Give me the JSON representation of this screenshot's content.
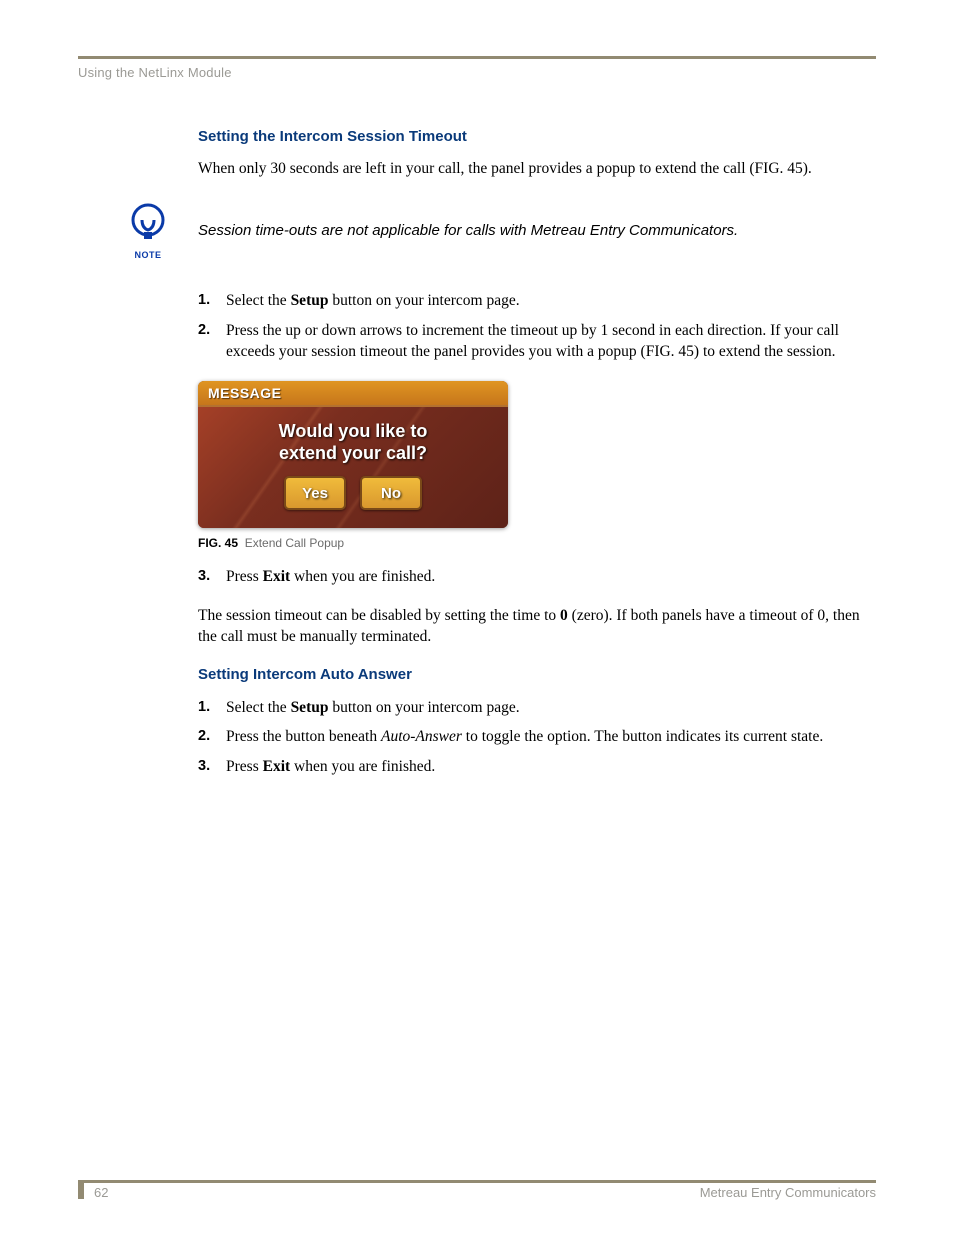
{
  "header": {
    "running_title": "Using the NetLinx Module"
  },
  "section1": {
    "heading": "Setting the Intercom Session Timeout",
    "intro": "When only 30 seconds are left in your call, the panel provides a popup to extend the call (FIG. 45).",
    "note": "Session time-outs are not applicable for calls with Metreau Entry Communicators.",
    "note_label": "NOTE",
    "step1_a": "Select the ",
    "step1_b": "Setup",
    "step1_c": " button on your intercom page.",
    "step2": "Press the up or down arrows to increment the timeout up by 1 second in each direction. If your call exceeds your session timeout the panel provides you with a popup (FIG. 45) to extend the session.",
    "step3_a": "Press ",
    "step3_b": "Exit",
    "step3_c": " when you are finished.",
    "closing_a": "The session timeout can be disabled by setting the time to ",
    "closing_b": "0",
    "closing_c": " (zero). If both panels have a timeout of 0, then the call must be manually terminated."
  },
  "figure": {
    "label": "FIG. 45",
    "caption": "Extend Call Popup",
    "popup_title": "MESSAGE",
    "popup_question": "Would you like to\nextend your call?",
    "btn_yes": "Yes",
    "btn_no": "No"
  },
  "section2": {
    "heading": "Setting Intercom Auto Answer",
    "step1_a": "Select the ",
    "step1_b": "Setup",
    "step1_c": " button on your intercom page.",
    "step2_a": "Press the button beneath ",
    "step2_b": "Auto-Answer",
    "step2_c": " to toggle the option. The button indicates its current state.",
    "step3_a": "Press ",
    "step3_b": "Exit",
    "step3_c": " when you are finished."
  },
  "footer": {
    "page_number": "62",
    "doc_title": "Metreau Entry Communicators"
  }
}
